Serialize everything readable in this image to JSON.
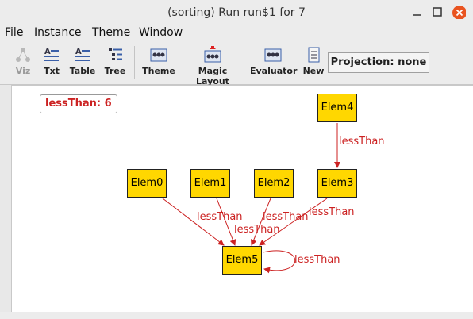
{
  "window": {
    "title": "(sorting) Run run$1 for 7"
  },
  "menu": {
    "file": "File",
    "instance": "Instance",
    "theme": "Theme",
    "window": "Window"
  },
  "toolbar": {
    "viz": "Viz",
    "txt": "Txt",
    "table": "Table",
    "tree": "Tree",
    "theme": "Theme",
    "magic_layout": "Magic Layout",
    "evaluator": "Evaluator",
    "new": "New",
    "projection": "Projection: none"
  },
  "graph": {
    "badge": "lessThan: 6",
    "nodes": {
      "elem0": "Elem0",
      "elem1": "Elem1",
      "elem2": "Elem2",
      "elem3": "Elem3",
      "elem4": "Elem4",
      "elem5": "Elem5"
    },
    "edge_labels": {
      "e4_3": "lessThan",
      "e0_5": "lessThan",
      "e1_5": "lessThan",
      "e2_5": "lessThan",
      "e3_5": "lessThan",
      "e5_5": "lessThan"
    }
  },
  "colors": {
    "node_fill": "#ffd700",
    "edge": "#cc2222",
    "canvas": "#ffffff"
  }
}
